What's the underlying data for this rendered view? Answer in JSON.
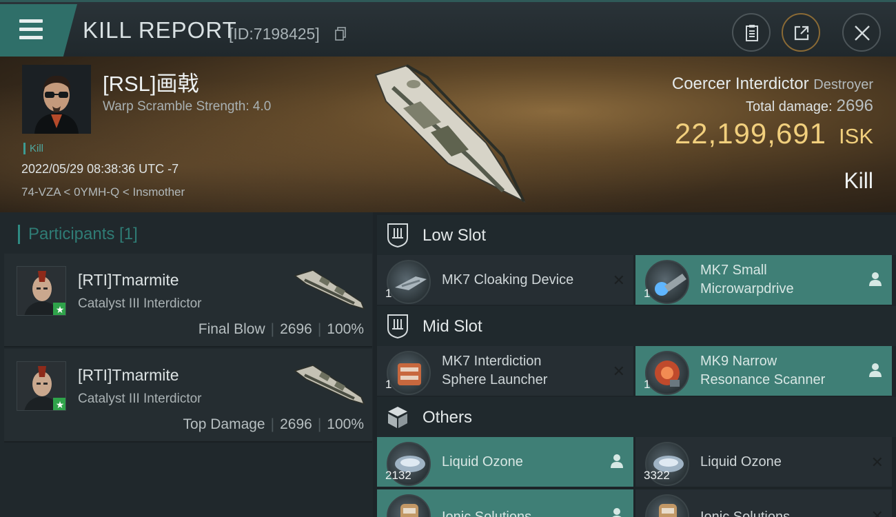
{
  "header": {
    "title": "KILL REPORT",
    "report_id": "[ID:7198425]"
  },
  "victim": {
    "name": "[RSL]画戟",
    "warp_scramble": "Warp Scramble Strength: 4.0",
    "tag": "Kill",
    "datetime": "2022/05/29 08:38:36 UTC -7",
    "location": "74-VZA < 0YMH-Q < Insmother",
    "ship_name": "Coercer Interdictor",
    "ship_class": "Destroyer",
    "total_damage_label": "Total damage:",
    "total_damage": "2696",
    "isk_value": "22,199,691",
    "isk_unit": "ISK",
    "result": "Kill"
  },
  "participants": {
    "heading": "Participants [1]",
    "rows": [
      {
        "name": "[RTI]Tmarmite",
        "ship": "Catalyst III Interdictor",
        "role": "Final Blow",
        "damage": "2696",
        "percent": "100%"
      },
      {
        "name": "[RTI]Tmarmite",
        "ship": "Catalyst III Interdictor",
        "role": "Top Damage",
        "damage": "2696",
        "percent": "100%"
      }
    ]
  },
  "fitting": {
    "low_slot": {
      "label": "Low Slot",
      "items": [
        {
          "name": "MK7 Cloaking Device",
          "qty": "1",
          "status": "destroyed"
        },
        {
          "name_line1": "MK7 Small",
          "name_line2": "Microwarpdrive",
          "qty": "1",
          "status": "dropped"
        }
      ]
    },
    "mid_slot": {
      "label": "Mid Slot",
      "items": [
        {
          "name_line1": "MK7 Interdiction",
          "name_line2": "Sphere Launcher",
          "qty": "1",
          "status": "destroyed"
        },
        {
          "name_line1": "MK9 Narrow",
          "name_line2": "Resonance Scanner",
          "qty": "1",
          "status": "dropped"
        }
      ]
    },
    "others": {
      "label": "Others",
      "items": [
        {
          "name": "Liquid Ozone",
          "qty": "2132",
          "status": "dropped"
        },
        {
          "name": "Liquid Ozone",
          "qty": "3322",
          "status": "destroyed"
        },
        {
          "name": "Ionic Solutions",
          "status": "dropped"
        },
        {
          "name": "Ionic Solutions",
          "status": "destroyed"
        }
      ]
    }
  },
  "colors": {
    "accent_teal": "#3f7f76",
    "isk_gold": "#f1cf7d",
    "menu_teal": "#2f6f69"
  }
}
